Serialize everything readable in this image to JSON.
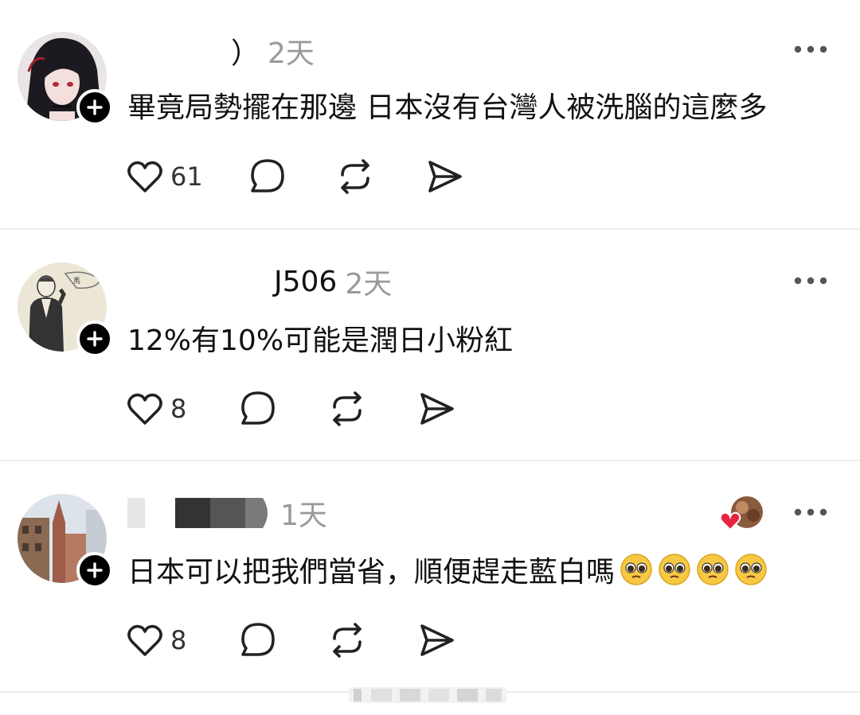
{
  "posts": [
    {
      "username": "）",
      "timestamp": "2天",
      "text": "畢竟局勢擺在那邊 日本沒有台灣人被洗腦的這麼多",
      "like_count": "61",
      "avatar_icon": "anime-girl-avatar"
    },
    {
      "username": "J506",
      "timestamp": "2天",
      "text": "12%有10%可能是潤日小粉紅",
      "like_count": "8",
      "avatar_icon": "sketch-man-avatar"
    },
    {
      "username": "",
      "timestamp": "1天",
      "text": "日本可以把我們當省，順便趕走藍白嗎",
      "emoji_count": 4,
      "like_count": "8",
      "avatar_icon": "cathedral-avatar"
    }
  ],
  "icons": {
    "like": "heart-outline-icon",
    "comment": "comment-bubble-icon",
    "repost": "repost-arrows-icon",
    "share": "send-paper-plane-icon",
    "more": "more-dots-icon",
    "follow": "plus-icon",
    "liked_by_author": "red-heart-icon"
  },
  "colors": {
    "text": "#111111",
    "muted": "#9a9a9a",
    "divider": "#ececec",
    "badge": "#000000",
    "heart_red": "#e8243f"
  }
}
